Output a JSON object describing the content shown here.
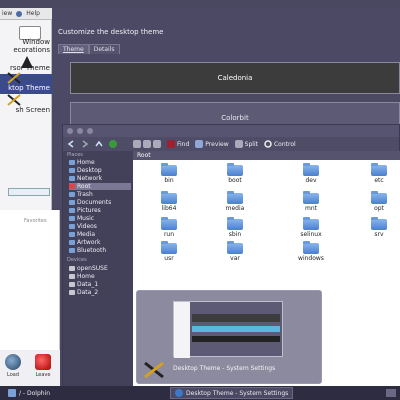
{
  "bg_menubar": {
    "items": [
      "iew",
      "Help"
    ]
  },
  "sidebar": {
    "items": [
      {
        "label": "Window",
        "sub": "ecorations"
      },
      {
        "label": "rsor Theme"
      },
      {
        "label": "ktop Theme",
        "active": true
      },
      {
        "label": "sh Screen"
      }
    ]
  },
  "main": {
    "title": "Customize the desktop theme",
    "tabs": [
      {
        "label": "Theme",
        "active": true
      },
      {
        "label": "Details"
      }
    ],
    "themes": [
      {
        "label": "Caledonia",
        "selected": true
      },
      {
        "label": "Colorbit"
      }
    ]
  },
  "lower_panel": {
    "favorites": "Favorites",
    "buttons": [
      {
        "label": "Load",
        "icon": "session-icon"
      },
      {
        "label": "Leave",
        "icon": "power-icon"
      }
    ]
  },
  "dolphin": {
    "toolbar": [
      {
        "label": "",
        "icon": "back-icon"
      },
      {
        "label": "",
        "icon": "forward-icon"
      },
      {
        "label": "",
        "icon": "up-icon"
      },
      {
        "label": "",
        "icon": "reload-icon"
      },
      {
        "label": "Find",
        "icon": "find-icon"
      },
      {
        "label": "Preview",
        "icon": "preview-icon"
      },
      {
        "label": "Split",
        "icon": "split-icon"
      },
      {
        "label": "Control",
        "icon": "control-icon"
      }
    ],
    "places_header": "Places",
    "places": [
      {
        "label": "Home"
      },
      {
        "label": "Desktop"
      },
      {
        "label": "Network"
      },
      {
        "label": "Root",
        "selected": true
      },
      {
        "label": "Trash"
      },
      {
        "label": "Documents"
      },
      {
        "label": "Pictures"
      },
      {
        "label": "Music"
      },
      {
        "label": "Videos"
      },
      {
        "label": "Media"
      },
      {
        "label": "Artwork"
      },
      {
        "label": "Bluetooth"
      }
    ],
    "devices_header": "Devices",
    "devices": [
      {
        "label": "openSUSE"
      },
      {
        "label": "Home"
      },
      {
        "label": "Data_1"
      },
      {
        "label": "Data_2"
      }
    ],
    "breadcrumb": "Root",
    "folders": [
      "bin",
      "boot",
      "dev",
      "etc",
      "lib64",
      "media",
      "mnt",
      "opt",
      "run",
      "sbin",
      "selinux",
      "srv",
      "usr",
      "var",
      "windows"
    ]
  },
  "switcher": {
    "label": "Desktop Theme - System Settings"
  },
  "taskbar": {
    "tasks": [
      {
        "label": "/ - Dolphin"
      },
      {
        "label": "Desktop Theme - System Settings",
        "active": true
      }
    ]
  }
}
